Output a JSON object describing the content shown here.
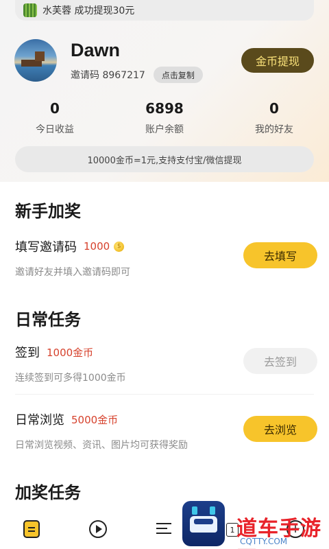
{
  "ticker": {
    "text": "水芙蓉 成功提现30元"
  },
  "profile": {
    "username": "Dawn",
    "invite_text": "邀请码 8967217",
    "copy_label": "点击复制",
    "withdraw_label": "金币提现"
  },
  "stats": [
    {
      "value": "0",
      "label": "今日收益"
    },
    {
      "value": "6898",
      "label": "账户余额"
    },
    {
      "value": "0",
      "label": "我的好友"
    }
  ],
  "rate_text": "10000金币=1元,支持支付宝/微信提现",
  "newbie": {
    "title": "新手加奖",
    "task": {
      "name": "填写邀请码",
      "reward": "1000",
      "desc": "邀请好友并填入邀请码即可",
      "button": "去填写"
    }
  },
  "daily": {
    "title": "日常任务",
    "tasks": [
      {
        "name": "签到",
        "reward": "1000金币",
        "desc": "连续签到可多得1000金币",
        "button": "去签到"
      },
      {
        "name": "日常浏览",
        "reward": "5000金币",
        "desc": "日常浏览视频、资讯、图片均可获得奖励",
        "button": "去浏览"
      }
    ]
  },
  "bonus": {
    "title": "加奖任务"
  },
  "nav": {
    "badge": "1",
    "plus": "+"
  },
  "watermark": {
    "text": "道车手游网",
    "sub": "CQTTY.COM"
  },
  "colors": {
    "accent": "#f7c42b",
    "reward": "#d6412c",
    "withdraw_bg": "#5a4a1c",
    "withdraw_text": "#fbe37a"
  }
}
